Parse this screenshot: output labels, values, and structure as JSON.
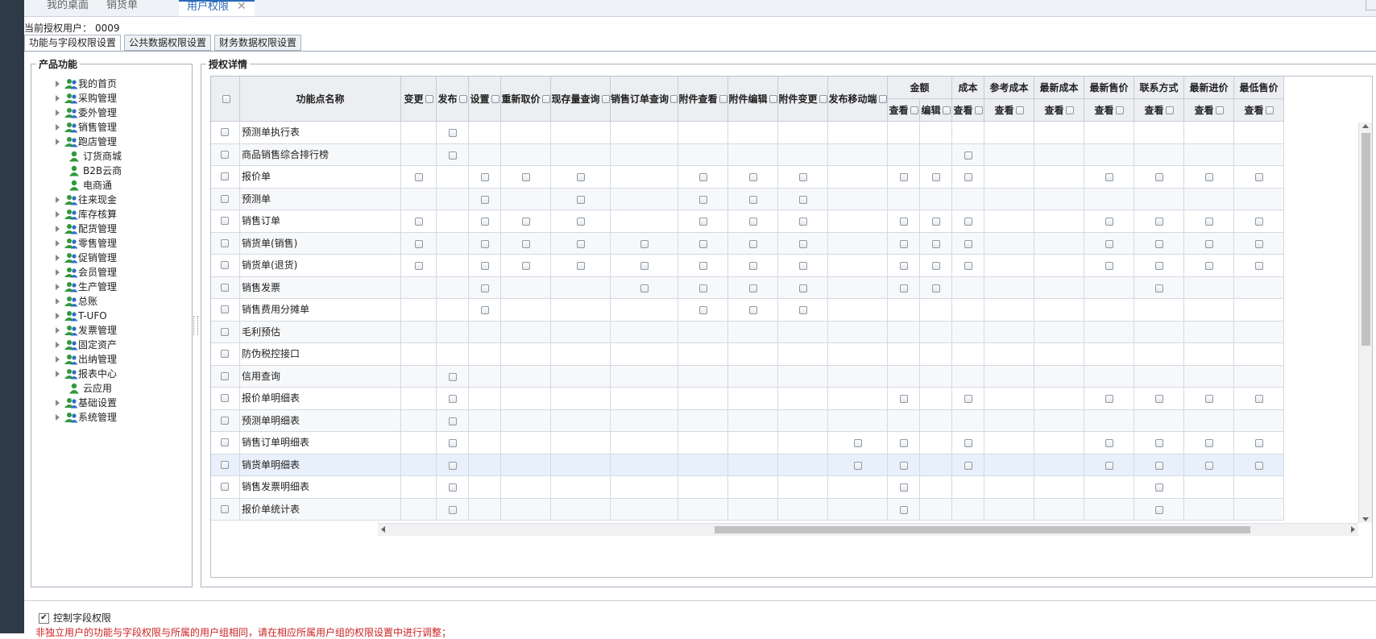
{
  "tabs": [
    {
      "label": "我的桌面",
      "active": false
    },
    {
      "label": "销货单",
      "active": false
    },
    {
      "label": "用户权限",
      "active": true
    }
  ],
  "current_user": {
    "label": "当前授权用户：",
    "value": "0009"
  },
  "subtabs": [
    {
      "label": "功能与字段权限设置",
      "active": true
    },
    {
      "label": "公共数据权限设置",
      "active": false
    },
    {
      "label": "财务数据权限设置",
      "active": false
    }
  ],
  "product_panel": {
    "title": "产品功能",
    "items": [
      {
        "label": "我的首页",
        "expandable": true
      },
      {
        "label": "采购管理",
        "expandable": true
      },
      {
        "label": "委外管理",
        "expandable": true
      },
      {
        "label": "销售管理",
        "expandable": true
      },
      {
        "label": "跑店管理",
        "expandable": true
      },
      {
        "label": "订货商城",
        "expandable": false
      },
      {
        "label": "B2B云商",
        "expandable": false
      },
      {
        "label": "电商通",
        "expandable": false
      },
      {
        "label": "往来现金",
        "expandable": true
      },
      {
        "label": "库存核算",
        "expandable": true
      },
      {
        "label": "配货管理",
        "expandable": true
      },
      {
        "label": "零售管理",
        "expandable": true
      },
      {
        "label": "促销管理",
        "expandable": true
      },
      {
        "label": "会员管理",
        "expandable": true
      },
      {
        "label": "生产管理",
        "expandable": true
      },
      {
        "label": "总账",
        "expandable": true
      },
      {
        "label": "T-UFO",
        "expandable": true
      },
      {
        "label": "发票管理",
        "expandable": true
      },
      {
        "label": "固定资产",
        "expandable": true
      },
      {
        "label": "出纳管理",
        "expandable": true
      },
      {
        "label": "报表中心",
        "expandable": true
      },
      {
        "label": "云应用",
        "expandable": false
      },
      {
        "label": "基础设置",
        "expandable": true
      },
      {
        "label": "系统管理",
        "expandable": true
      }
    ]
  },
  "auth_panel": {
    "title": "授权详情",
    "name_header": "功能点名称",
    "columns": [
      {
        "label": "变更"
      },
      {
        "label": "发布"
      },
      {
        "label": "设置"
      },
      {
        "label": "重新取价"
      },
      {
        "label": "现存量查询"
      },
      {
        "label": "销售订单查询"
      },
      {
        "label": "附件查看"
      },
      {
        "label": "附件编辑"
      },
      {
        "label": "附件变更"
      },
      {
        "label": "发布移动端"
      }
    ],
    "groups": [
      {
        "label": "金额",
        "subs": [
          "查看",
          "编辑"
        ]
      },
      {
        "label": "成本",
        "subs": [
          "查看"
        ]
      },
      {
        "label": "参考成本",
        "subs": [
          "查看"
        ]
      },
      {
        "label": "最新成本",
        "subs": [
          "查看"
        ]
      },
      {
        "label": "最新售价",
        "subs": [
          "查看"
        ]
      },
      {
        "label": "联系方式",
        "subs": [
          "查看"
        ]
      },
      {
        "label": "最新进价",
        "subs": [
          "查看"
        ]
      },
      {
        "label": "最低售价",
        "subs": [
          "查看"
        ]
      }
    ],
    "rows": [
      {
        "name": "预测单执行表",
        "checks": [
          1
        ]
      },
      {
        "name": "商品销售综合排行榜",
        "checks": [
          1,
          12
        ]
      },
      {
        "name": "报价单",
        "checks": [
          0,
          2,
          3,
          4,
          6,
          7,
          8,
          10,
          11,
          12,
          15,
          16,
          17,
          18
        ]
      },
      {
        "name": "预测单",
        "checks": [
          2,
          4,
          6,
          7,
          8
        ]
      },
      {
        "name": "销售订单",
        "checks": [
          0,
          2,
          3,
          4,
          6,
          7,
          8,
          10,
          11,
          12,
          15,
          16,
          17,
          18
        ]
      },
      {
        "name": "销货单(销售)",
        "checks": [
          0,
          2,
          3,
          4,
          5,
          6,
          7,
          8,
          10,
          11,
          12,
          15,
          16,
          17,
          18
        ]
      },
      {
        "name": "销货单(退货)",
        "checks": [
          0,
          2,
          3,
          4,
          5,
          6,
          7,
          8,
          10,
          11,
          12,
          15,
          16,
          17,
          18
        ]
      },
      {
        "name": "销售发票",
        "checks": [
          2,
          5,
          6,
          7,
          8,
          10,
          11,
          16
        ]
      },
      {
        "name": "销售费用分摊单",
        "checks": [
          2,
          6,
          7,
          8
        ]
      },
      {
        "name": "毛利预估",
        "checks": []
      },
      {
        "name": "防伪税控接口",
        "checks": []
      },
      {
        "name": "信用查询",
        "checks": [
          1
        ]
      },
      {
        "name": "报价单明细表",
        "checks": [
          1,
          10,
          12,
          15,
          16,
          17,
          18
        ]
      },
      {
        "name": "预测单明细表",
        "checks": [
          1
        ]
      },
      {
        "name": "销售订单明细表",
        "checks": [
          1,
          9,
          10,
          12,
          15,
          16,
          17,
          18
        ]
      },
      {
        "name": "销货单明细表",
        "checks": [
          1,
          9,
          10,
          12,
          15,
          16,
          17,
          18
        ],
        "highlight": true
      },
      {
        "name": "销售发票明细表",
        "checks": [
          1,
          10,
          16
        ]
      },
      {
        "name": "报价单统计表",
        "checks": [
          1,
          10,
          16
        ]
      }
    ]
  },
  "control_field": {
    "label": "控制字段权限",
    "checked": true
  },
  "warning": "非独立用户的功能与字段权限与所属的用户组相同，请在相应所属用户组的权限设置中进行调整；",
  "colors": {
    "accent": "#2a6ab8",
    "warning": "#cc2222",
    "highlight_row": "#e8f0fb"
  }
}
